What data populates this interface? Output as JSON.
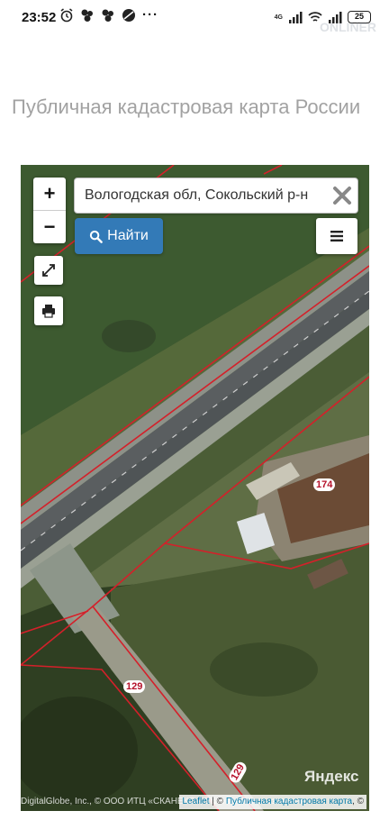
{
  "status_bar": {
    "time": "23:52",
    "more": "···",
    "network": "4G",
    "battery": "25",
    "watermark": "ONLINER"
  },
  "page": {
    "title": "Публичная кадастровая карта России"
  },
  "map": {
    "zoom_in": "+",
    "zoom_out": "−",
    "search_value": "Вологодская обл, Сокольский р-н",
    "find_label": "Найти",
    "parcels": [
      "174",
      "129",
      "129"
    ],
    "provider_logo": "Яндекс",
    "attribution_left": "DigitalGlobe, Inc., © ООО ИТЦ «СКАНЕКС», Условия использования",
    "attribution_leaflet": "Leaflet",
    "attribution_sep": " | © ",
    "attribution_pkk": "Публичная кадастровая карта",
    "attribution_end": ", ©",
    "colors": {
      "parcel_border": "#d4202a",
      "button_primary": "#337ab7"
    }
  }
}
